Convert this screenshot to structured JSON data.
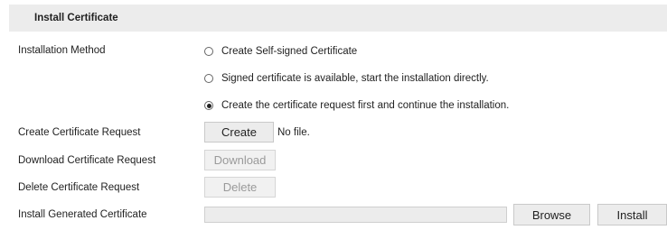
{
  "section": {
    "title": "Install Certificate"
  },
  "installation_method": {
    "label": "Installation Method",
    "options": [
      {
        "label": "Create Self-signed Certificate",
        "selected": false
      },
      {
        "label": "Signed certificate is available, start the installation directly.",
        "selected": false
      },
      {
        "label": "Create the certificate request first and continue the installation.",
        "selected": true
      }
    ]
  },
  "create_request": {
    "label": "Create Certificate Request",
    "button": "Create",
    "status": "No file."
  },
  "download_request": {
    "label": "Download Certificate Request",
    "button": "Download"
  },
  "delete_request": {
    "label": "Delete Certificate Request",
    "button": "Delete"
  },
  "install_generated": {
    "label": "Install Generated Certificate",
    "path_value": "",
    "browse_button": "Browse",
    "install_button": "Install"
  }
}
